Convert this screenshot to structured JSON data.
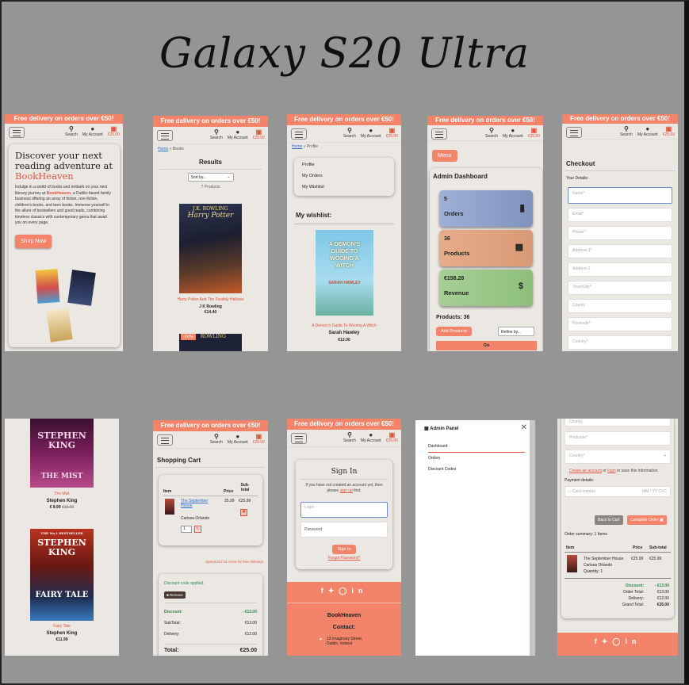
{
  "page_title": "Galaxy S20 Ultra",
  "banner": "Free delivery on orders over €50!",
  "header": {
    "search": "Search",
    "account": "My Account",
    "bag": "€25.00"
  },
  "home": {
    "heading_1": "Discover your next",
    "heading_2": "reading adventure at",
    "brand": "BookHeaven",
    "intro_a": "Indulge in a world of books and embark on your next literary journey at",
    "intro_brand": "BookHeaven",
    "intro_b": ", a Dublin-based family business offering an array of fiction, non-fiction, children's books, and teen books. Immerse yourself in the allure of bestsellers and good reads, combining timeless classics with contemporary gems that await you on every page.",
    "shop_now": "Shop Now"
  },
  "books": {
    "breadcrumb_home": "Home",
    "breadcrumb_current": "Books",
    "heading": "Results",
    "sort": "Sort by...",
    "count": "7 Products",
    "book1_title": "Harry Potter And The Deathly Hallows",
    "book1_author": "J K Rowling",
    "book1_price": "€14.40",
    "book1_cover_author": "J.K. ROWLING",
    "book1_cover_title": "Harry Potter",
    "book2_badge": "-10%",
    "book2_cover_author": "ROWLING"
  },
  "profile": {
    "breadcrumb_home": "Home",
    "breadcrumb_current": "Profile",
    "menu": [
      "Profile",
      "My Orders",
      "My Wishlist"
    ],
    "wishlist_heading": "My wishlist:",
    "cover_title": "A DEMON'S GUIDE TO WOOING A WITCH",
    "cover_author": "SARAH HAWLEY",
    "book_title": "A Demon's Guide To Wooing A Witch",
    "book_author": "Sarah Hawley",
    "book_price": "€12.00"
  },
  "admin": {
    "menu_button": "Menu",
    "heading": "Admin Dashboard",
    "orders_value": "5",
    "orders_label": "Orders",
    "products_value": "36",
    "products_label": "Products",
    "revenue_value": "€158.28",
    "revenue_label": "Revenue",
    "products_count": "Products: 36",
    "add_products": "Add Products",
    "refine": "Refine by...",
    "on": "On"
  },
  "checkout": {
    "heading": "Checkout",
    "details": "Your Details:",
    "fields": [
      "Name*",
      "Email*",
      "Phone*",
      "Address 1*",
      "Address 2",
      "Town/City*",
      "County",
      "Postcode*",
      "Country*"
    ]
  },
  "stephen": {
    "book1_cover_author": "STEPHEN KING",
    "book1_cover_title": "THE MIST",
    "book1_title": "The Mist",
    "book1_author": "Stephen King",
    "book1_price": "€ 8.99",
    "book1_old": "€10.00",
    "book2_cover_top": "THE No.1 BESTSELLER",
    "book2_cover_author": "STEPHEN KING",
    "book2_cover_title": "FAIRY TALE",
    "book2_title": "Fairy Tale",
    "book2_author": "Stephen King",
    "book2_price": "€11.99"
  },
  "cart": {
    "heading": "Shopping Cart",
    "col_item": "Item",
    "col_price": "Price",
    "col_sub": "Sub-total",
    "item_title": "The September House",
    "item_author": "Carissa Orlando",
    "item_price": "25.99",
    "item_sub": "€25.99",
    "qty": "1",
    "spend_more": "Spend €17.01 more for free delivery!",
    "discount_applied": "Discount code applied.",
    "remove": "Remove",
    "discount_label": "Discount:",
    "discount_value": "- €13.00",
    "subtotal_label": "SubTotal:",
    "subtotal_value": "€13.00",
    "delivery_label": "Delivery:",
    "delivery_value": "€12.00",
    "total_label": "Total:",
    "total_value": "€25.00"
  },
  "signin": {
    "heading": "Sign In",
    "text_a": "If you have not created an account yet, then please",
    "signup": "sign up",
    "text_b": "first.",
    "login_placeholder": "Login",
    "password_placeholder": "Password",
    "button": "Sign In",
    "forgot": "Forgot Password?",
    "brand": "BookHeaven",
    "contact": "Contact:",
    "address_1": "13 Imaginary Street,",
    "address_2": "Dublin, Ireland"
  },
  "panel": {
    "heading": "Admin Panel",
    "items": [
      "Dashboard",
      "Orders",
      "Discount Codes"
    ]
  },
  "checkout2": {
    "field_county": "County:",
    "field_postcode": "Postcode*",
    "field_country": "Country*",
    "create_account": "Create an account",
    "or": "or",
    "login": "login",
    "save_info": "to save this information",
    "payment": "Payment details:",
    "card_number": "Card number",
    "card_exp": "MM / YY  CVC",
    "back": "Back to Cart",
    "complete": "Complete Order",
    "summary": "Order summary: 1 Items",
    "col_item": "Item",
    "col_price": "Price",
    "col_sub": "Sub-total",
    "item_title": "The September House",
    "item_author": "Carissa Orlando",
    "item_qty": "Quantity: 1",
    "item_price": "€25.99",
    "item_sub": "€25.99",
    "discount_label": "Discount:",
    "discount_value": "- €13.00",
    "order_total_label": "Order Total:",
    "order_total_value": "€13.00",
    "delivery_label": "Delivery:",
    "delivery_value": "€12.00",
    "grand_label": "Grand Total:",
    "grand_value": "€25.00"
  },
  "colors": {
    "accent": "#f3846a",
    "background": "#959595",
    "panel": "#ebe8e3"
  }
}
